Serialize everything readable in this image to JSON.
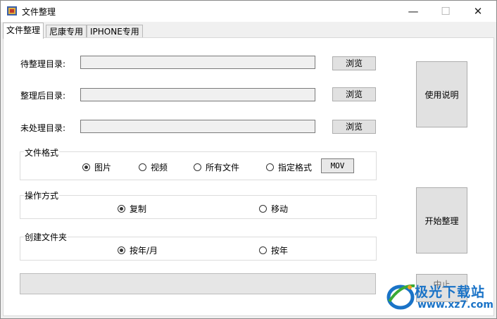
{
  "window": {
    "title": "文件整理",
    "controls": {
      "minimize": "—",
      "maximize": "☐",
      "close": "✕"
    }
  },
  "tabs": [
    {
      "label": "文件整理",
      "active": true
    },
    {
      "label": "尼康专用",
      "active": false
    },
    {
      "label": "IPHONE专用",
      "active": false
    }
  ],
  "directories": {
    "source_label": "待整理目录:",
    "source_value": "",
    "target_label": "整理后目录:",
    "target_value": "",
    "unprocessed_label": "未处理目录:",
    "unprocessed_value": "",
    "browse_label": "浏览"
  },
  "file_format": {
    "title": "文件格式",
    "options": [
      "图片",
      "视频",
      "所有文件",
      "指定格式"
    ],
    "selected": "图片",
    "custom_value": "MOV"
  },
  "operation": {
    "title": "操作方式",
    "options": [
      "复制",
      "移动"
    ],
    "selected": "复制"
  },
  "create_folder": {
    "title": "创建文件夹",
    "options": [
      "按年/月",
      "按年"
    ],
    "selected": "按年/月"
  },
  "buttons": {
    "help": "使用说明",
    "start": "开始整理",
    "stop": "中止"
  },
  "progress": {
    "value": 0
  },
  "watermark": {
    "brand": "极光下载站",
    "url": "www.xz7.com"
  }
}
